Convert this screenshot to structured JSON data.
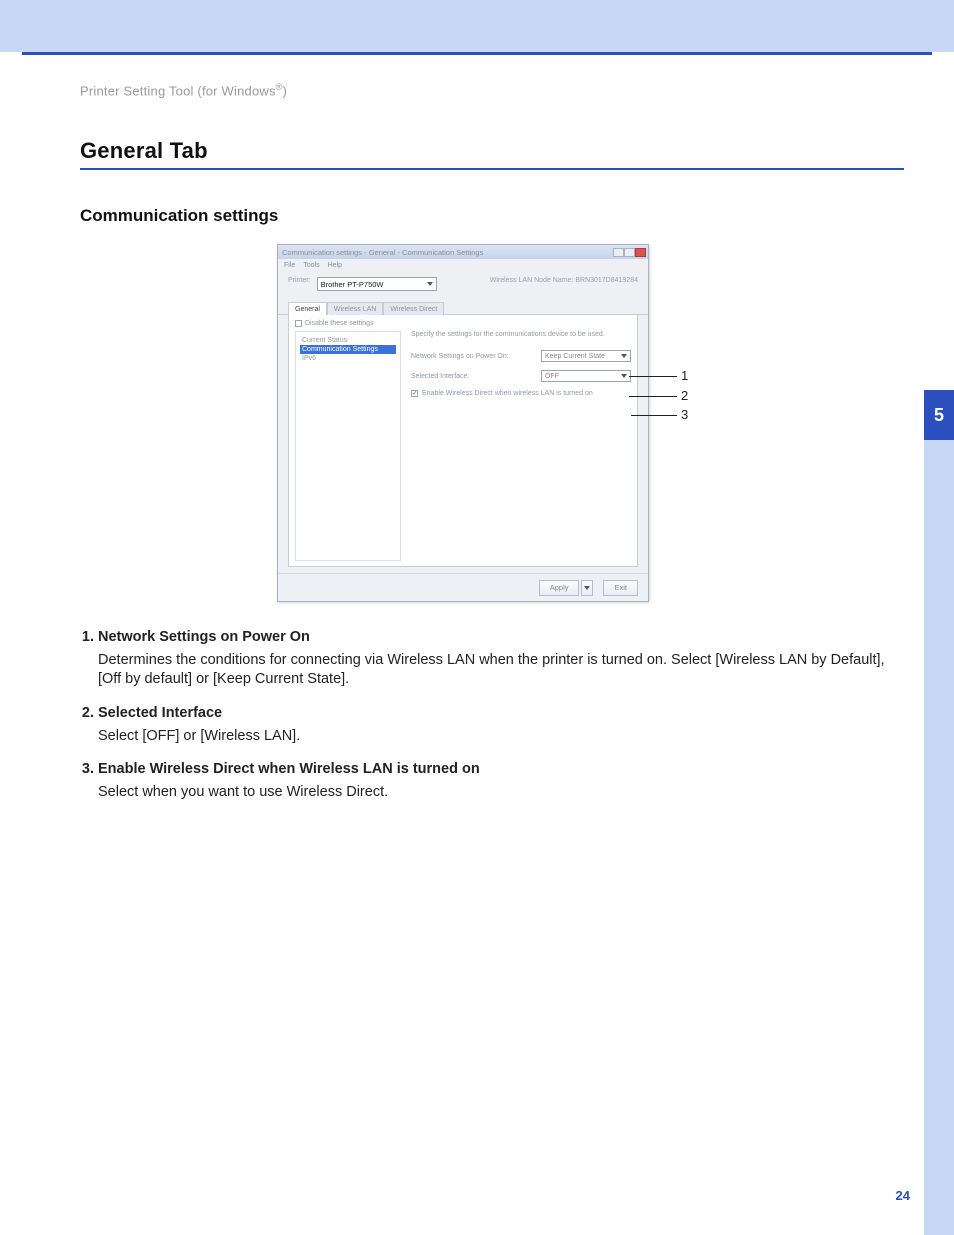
{
  "breadcrumb_prefix": "Printer Setting Tool (for Windows",
  "breadcrumb_suffix": ")",
  "reg_mark": "®",
  "section_title": "General Tab",
  "subsection_title": "Communication settings",
  "chapter_number": "5",
  "page_number": "24",
  "dialog": {
    "title": "Communication settings - General - Communication Settings",
    "menus": [
      "File",
      "Tools",
      "Help"
    ],
    "printer_label": "Printer:",
    "printer_value": "Brother PT-P750W",
    "node_name": "Wireless LAN Node Name: BRN3017D8419284",
    "tabs": [
      "General",
      "Wireless LAN",
      "Wireless Direct"
    ],
    "disable_checkbox_label": "Disable these settings",
    "tree": {
      "item1": "Current Status",
      "selected": "Communication Settings",
      "item3": "IPv6"
    },
    "intro": "Specify the settings for the communications device to be used.",
    "field1_label": "Network Settings on Power On:",
    "field1_value": "Keep Current State",
    "field2_label": "Selected Interface:",
    "field2_value": "OFF",
    "checkbox_label": "Enable Wireless Direct when wireless LAN is turned on",
    "apply_btn": "Apply",
    "exit_btn": "Exit"
  },
  "callouts": {
    "n1": "1",
    "n2": "2",
    "n3": "3"
  },
  "list": {
    "i1t": "Network Settings on Power On",
    "i1d": "Determines the conditions for connecting via Wireless LAN when the printer is turned on. Select [Wireless LAN by Default], [Off by default] or [Keep Current State].",
    "i2t": "Selected Interface",
    "i2d": "Select [OFF] or [Wireless LAN].",
    "i3t": "Enable Wireless Direct when Wireless LAN is turned on",
    "i3d": "Select when you want to use Wireless Direct."
  }
}
